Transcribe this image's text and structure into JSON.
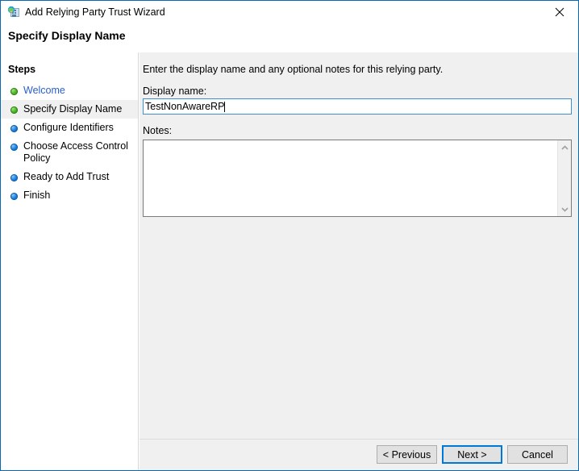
{
  "window": {
    "title": "Add Relying Party Trust Wizard",
    "icon": "wizard-globe-icon",
    "close_label": "✕",
    "border_color": "#0a69b7"
  },
  "header": {
    "title": "Specify Display Name"
  },
  "sidebar": {
    "heading": "Steps",
    "items": [
      {
        "label": "Welcome",
        "state": "done",
        "current": false,
        "link": true
      },
      {
        "label": "Specify Display Name",
        "state": "done",
        "current": true,
        "link": false
      },
      {
        "label": "Configure Identifiers",
        "state": "pending",
        "current": false,
        "link": false
      },
      {
        "label": "Choose Access Control Policy",
        "state": "pending",
        "current": false,
        "link": false
      },
      {
        "label": "Ready to Add Trust",
        "state": "pending",
        "current": false,
        "link": false
      },
      {
        "label": "Finish",
        "state": "pending",
        "current": false,
        "link": false
      }
    ],
    "bullet_done_color": "#49b827",
    "bullet_pending_color": "#1b82e0",
    "link_color": "#2a5fc9"
  },
  "main": {
    "intro": "Enter the display name and any optional notes for this relying party.",
    "display_name_label": "Display name:",
    "display_name_value": "TestNonAwareRP",
    "display_name_placeholder": "",
    "notes_label": "Notes:",
    "notes_value": "",
    "notes_placeholder": "",
    "scroll_up_icon": "chevron-up-icon",
    "scroll_down_icon": "chevron-down-icon"
  },
  "footer": {
    "previous_label": "< Previous",
    "next_label": "Next >",
    "cancel_label": "Cancel",
    "default_button": "Next >",
    "focus_color": "#0078d7"
  }
}
